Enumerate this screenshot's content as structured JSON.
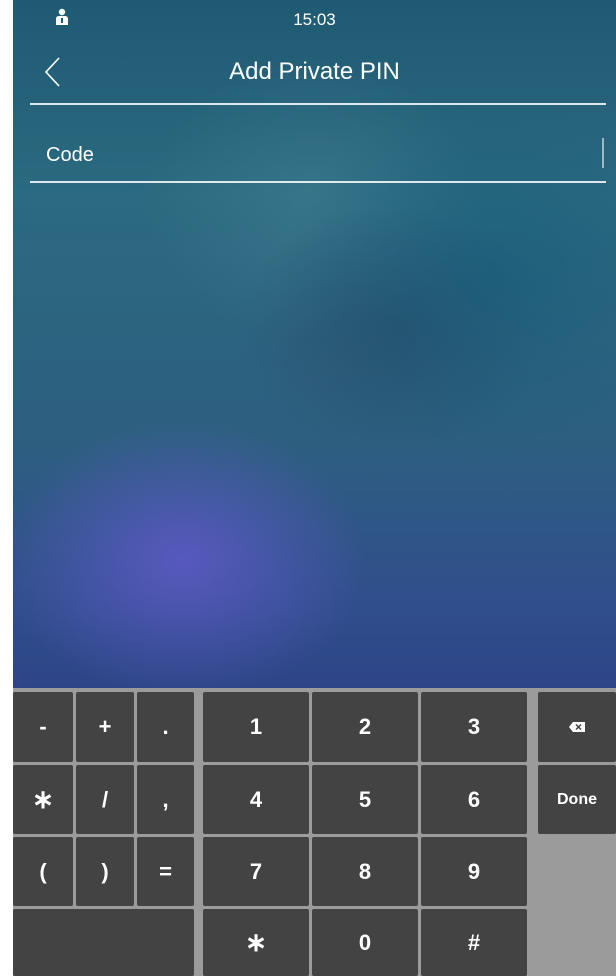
{
  "status_bar": {
    "time": "15:03",
    "icon": "user-badge-icon"
  },
  "header": {
    "title": "Add Private PIN",
    "back_icon": "chevron-left-icon"
  },
  "form": {
    "code_label": "Code",
    "code_value": ""
  },
  "keyboard": {
    "symbol_keys": [
      "-",
      "+",
      ".",
      "∗",
      "/",
      ",",
      "(",
      ")",
      "="
    ],
    "digit_keys": [
      "1",
      "2",
      "3",
      "4",
      "5",
      "6",
      "7",
      "8",
      "9",
      "∗",
      "0",
      "#"
    ],
    "backspace_icon": "backspace-icon",
    "done_label": "Done"
  },
  "colors": {
    "key_background": "#434343",
    "keyboard_background": "#9b9b9b",
    "text": "#ffffff"
  }
}
